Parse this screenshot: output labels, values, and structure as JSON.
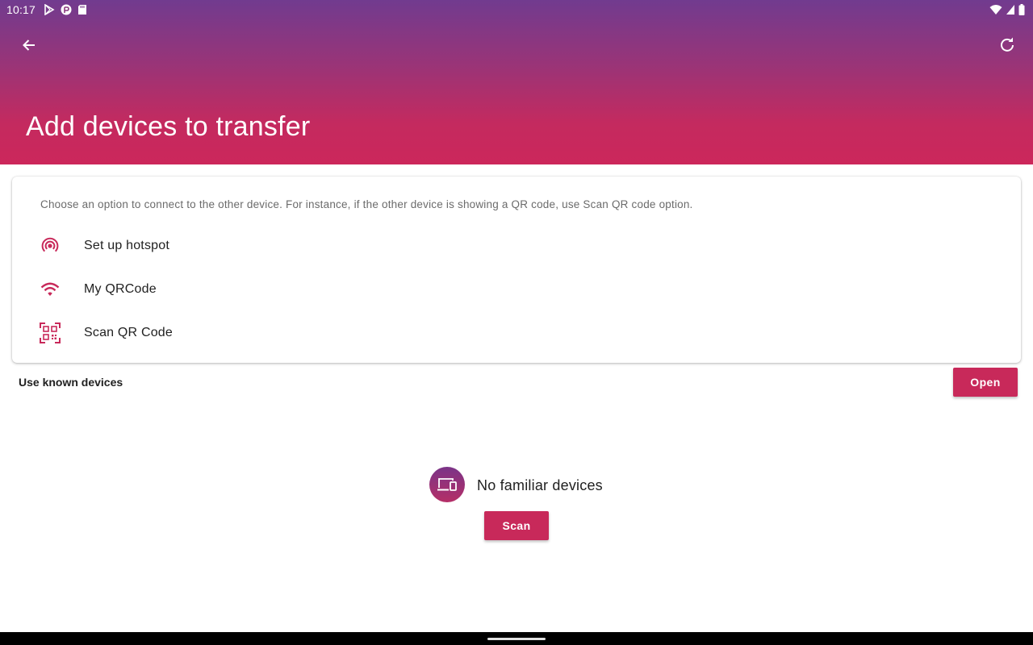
{
  "status_bar": {
    "time": "10:17",
    "left_icons": [
      "play-store-icon",
      "app-notification-icon",
      "sd-card-icon"
    ],
    "right_icons": [
      "wifi-icon",
      "cell-signal-icon",
      "battery-icon"
    ]
  },
  "toolbar": {
    "back_icon": "arrow-back-icon",
    "refresh_icon": "refresh-icon",
    "title": "Add devices to transfer"
  },
  "connect_card": {
    "description": "Choose an option to connect to the other device. For instance, if the other device is showing a QR code, use Scan QR code option.",
    "options": [
      {
        "label": "Set up hotspot",
        "icon": "hotspot-icon"
      },
      {
        "label": "My QRCode",
        "icon": "wifi-icon"
      },
      {
        "label": "Scan QR Code",
        "icon": "qr-scan-icon"
      }
    ]
  },
  "known_devices": {
    "label": "Use known devices",
    "open_label": "Open"
  },
  "empty_state": {
    "icon": "devices-icon",
    "text": "No familiar devices",
    "scan_label": "Scan"
  },
  "colors": {
    "accent": "#c8295a",
    "header_top": "#713b8f",
    "header_bottom": "#cc275b"
  }
}
